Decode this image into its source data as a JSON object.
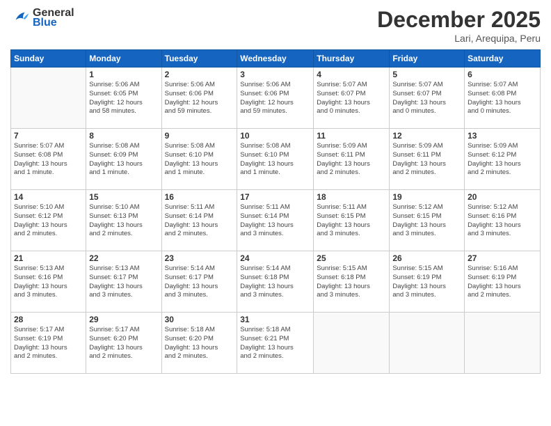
{
  "header": {
    "logo_line1": "General",
    "logo_line2": "Blue",
    "month": "December 2025",
    "location": "Lari, Arequipa, Peru"
  },
  "days_of_week": [
    "Sunday",
    "Monday",
    "Tuesday",
    "Wednesday",
    "Thursday",
    "Friday",
    "Saturday"
  ],
  "weeks": [
    [
      {
        "day": "",
        "info": ""
      },
      {
        "day": "1",
        "info": "Sunrise: 5:06 AM\nSunset: 6:05 PM\nDaylight: 12 hours\nand 58 minutes."
      },
      {
        "day": "2",
        "info": "Sunrise: 5:06 AM\nSunset: 6:06 PM\nDaylight: 12 hours\nand 59 minutes."
      },
      {
        "day": "3",
        "info": "Sunrise: 5:06 AM\nSunset: 6:06 PM\nDaylight: 12 hours\nand 59 minutes."
      },
      {
        "day": "4",
        "info": "Sunrise: 5:07 AM\nSunset: 6:07 PM\nDaylight: 13 hours\nand 0 minutes."
      },
      {
        "day": "5",
        "info": "Sunrise: 5:07 AM\nSunset: 6:07 PM\nDaylight: 13 hours\nand 0 minutes."
      },
      {
        "day": "6",
        "info": "Sunrise: 5:07 AM\nSunset: 6:08 PM\nDaylight: 13 hours\nand 0 minutes."
      }
    ],
    [
      {
        "day": "7",
        "info": "Sunrise: 5:07 AM\nSunset: 6:08 PM\nDaylight: 13 hours\nand 1 minute."
      },
      {
        "day": "8",
        "info": "Sunrise: 5:08 AM\nSunset: 6:09 PM\nDaylight: 13 hours\nand 1 minute."
      },
      {
        "day": "9",
        "info": "Sunrise: 5:08 AM\nSunset: 6:10 PM\nDaylight: 13 hours\nand 1 minute."
      },
      {
        "day": "10",
        "info": "Sunrise: 5:08 AM\nSunset: 6:10 PM\nDaylight: 13 hours\nand 1 minute."
      },
      {
        "day": "11",
        "info": "Sunrise: 5:09 AM\nSunset: 6:11 PM\nDaylight: 13 hours\nand 2 minutes."
      },
      {
        "day": "12",
        "info": "Sunrise: 5:09 AM\nSunset: 6:11 PM\nDaylight: 13 hours\nand 2 minutes."
      },
      {
        "day": "13",
        "info": "Sunrise: 5:09 AM\nSunset: 6:12 PM\nDaylight: 13 hours\nand 2 minutes."
      }
    ],
    [
      {
        "day": "14",
        "info": "Sunrise: 5:10 AM\nSunset: 6:12 PM\nDaylight: 13 hours\nand 2 minutes."
      },
      {
        "day": "15",
        "info": "Sunrise: 5:10 AM\nSunset: 6:13 PM\nDaylight: 13 hours\nand 2 minutes."
      },
      {
        "day": "16",
        "info": "Sunrise: 5:11 AM\nSunset: 6:14 PM\nDaylight: 13 hours\nand 2 minutes."
      },
      {
        "day": "17",
        "info": "Sunrise: 5:11 AM\nSunset: 6:14 PM\nDaylight: 13 hours\nand 3 minutes."
      },
      {
        "day": "18",
        "info": "Sunrise: 5:11 AM\nSunset: 6:15 PM\nDaylight: 13 hours\nand 3 minutes."
      },
      {
        "day": "19",
        "info": "Sunrise: 5:12 AM\nSunset: 6:15 PM\nDaylight: 13 hours\nand 3 minutes."
      },
      {
        "day": "20",
        "info": "Sunrise: 5:12 AM\nSunset: 6:16 PM\nDaylight: 13 hours\nand 3 minutes."
      }
    ],
    [
      {
        "day": "21",
        "info": "Sunrise: 5:13 AM\nSunset: 6:16 PM\nDaylight: 13 hours\nand 3 minutes."
      },
      {
        "day": "22",
        "info": "Sunrise: 5:13 AM\nSunset: 6:17 PM\nDaylight: 13 hours\nand 3 minutes."
      },
      {
        "day": "23",
        "info": "Sunrise: 5:14 AM\nSunset: 6:17 PM\nDaylight: 13 hours\nand 3 minutes."
      },
      {
        "day": "24",
        "info": "Sunrise: 5:14 AM\nSunset: 6:18 PM\nDaylight: 13 hours\nand 3 minutes."
      },
      {
        "day": "25",
        "info": "Sunrise: 5:15 AM\nSunset: 6:18 PM\nDaylight: 13 hours\nand 3 minutes."
      },
      {
        "day": "26",
        "info": "Sunrise: 5:15 AM\nSunset: 6:19 PM\nDaylight: 13 hours\nand 3 minutes."
      },
      {
        "day": "27",
        "info": "Sunrise: 5:16 AM\nSunset: 6:19 PM\nDaylight: 13 hours\nand 2 minutes."
      }
    ],
    [
      {
        "day": "28",
        "info": "Sunrise: 5:17 AM\nSunset: 6:19 PM\nDaylight: 13 hours\nand 2 minutes."
      },
      {
        "day": "29",
        "info": "Sunrise: 5:17 AM\nSunset: 6:20 PM\nDaylight: 13 hours\nand 2 minutes."
      },
      {
        "day": "30",
        "info": "Sunrise: 5:18 AM\nSunset: 6:20 PM\nDaylight: 13 hours\nand 2 minutes."
      },
      {
        "day": "31",
        "info": "Sunrise: 5:18 AM\nSunset: 6:21 PM\nDaylight: 13 hours\nand 2 minutes."
      },
      {
        "day": "",
        "info": ""
      },
      {
        "day": "",
        "info": ""
      },
      {
        "day": "",
        "info": ""
      }
    ]
  ]
}
